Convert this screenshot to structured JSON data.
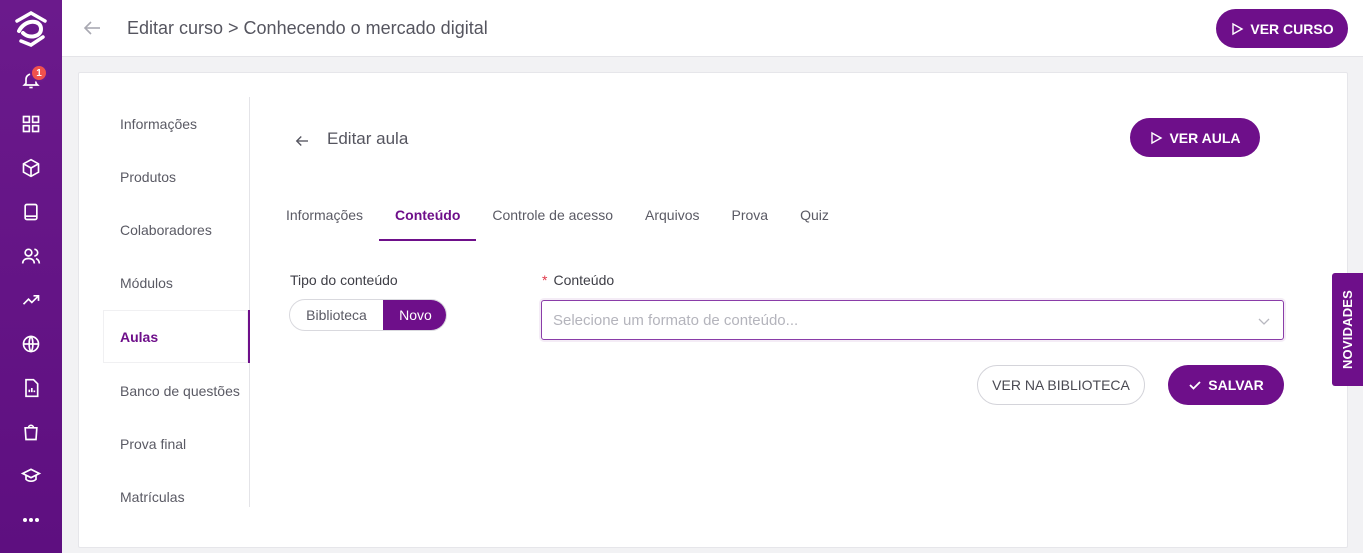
{
  "topbar": {
    "title": "Editar curso > Conhecendo o mercado digital",
    "ver_curso": "VER CURSO"
  },
  "rail": {
    "notification_count": "1",
    "icons": [
      "bell-icon",
      "grid-icon",
      "box-icon",
      "book-icon",
      "users-icon",
      "trending-icon",
      "globe-icon",
      "report-icon",
      "shopping-bag-icon",
      "graduation-cap-icon",
      "more-icon"
    ]
  },
  "side_nav": {
    "items": [
      {
        "label": "Informações"
      },
      {
        "label": "Produtos"
      },
      {
        "label": "Colaboradores"
      },
      {
        "label": "Módulos"
      },
      {
        "label": "Aulas"
      },
      {
        "label": "Banco de questões"
      },
      {
        "label": "Prova final"
      },
      {
        "label": "Matrículas"
      }
    ],
    "active": "Aulas"
  },
  "lesson": {
    "title": "Editar aula",
    "ver_aula": "VER AULA"
  },
  "tabs": [
    {
      "label": "Informações"
    },
    {
      "label": "Conteúdo"
    },
    {
      "label": "Controle de acesso"
    },
    {
      "label": "Arquivos"
    },
    {
      "label": "Prova"
    },
    {
      "label": "Quiz"
    }
  ],
  "active_tab": "Conteúdo",
  "form": {
    "tipo_label": "Tipo do conteúdo",
    "tipo_options": [
      "Biblioteca",
      "Novo"
    ],
    "tipo_selected": "Novo",
    "conteudo_required": "*",
    "conteudo_label": "Conteúdo",
    "conteudo_placeholder": "Selecione um formato de conteúdo...",
    "ver_biblioteca": "VER NA BIBLIOTECA",
    "salvar": "SALVAR"
  },
  "novidades": "NOVIDADES",
  "colors": {
    "brand": "#6e0f8a",
    "rail": "#6b1a8c",
    "badge": "#f0524d"
  }
}
